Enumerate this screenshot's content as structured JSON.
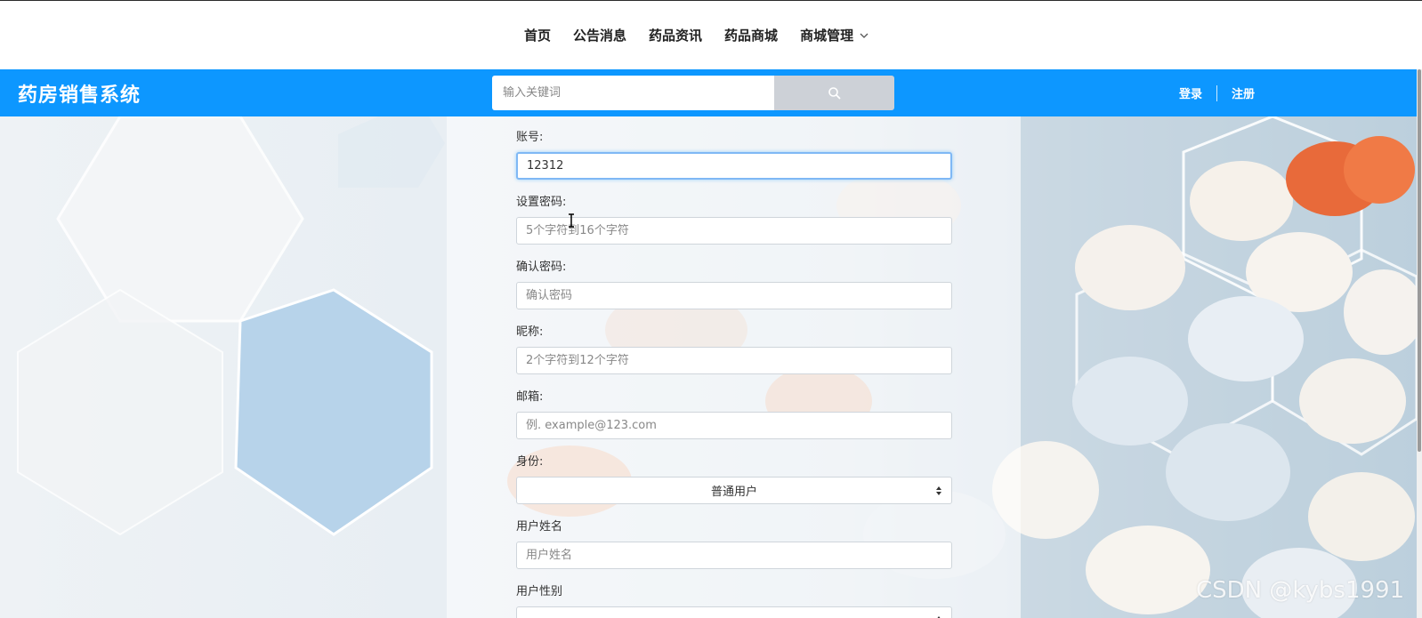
{
  "nav": {
    "items": [
      "首页",
      "公告消息",
      "药品资讯",
      "药品商城",
      "商城管理"
    ]
  },
  "header": {
    "brand": "药房销售系统",
    "search_placeholder": "输入关键词",
    "login": "登录",
    "register": "注册",
    "bar_color": "#0d97ff"
  },
  "form": {
    "account": {
      "label": "账号:",
      "value": "12312"
    },
    "password": {
      "label": "设置密码:",
      "placeholder": "5个字符到16个字符"
    },
    "confirm": {
      "label": "确认密码:",
      "placeholder": "确认密码"
    },
    "nickname": {
      "label": "昵称:",
      "placeholder": "2个字符到12个字符"
    },
    "email": {
      "label": "邮箱:",
      "placeholder": "例. example@123.com"
    },
    "role": {
      "label": "身份:",
      "value": "普通用户"
    },
    "realname": {
      "label": "用户姓名",
      "placeholder": "用户姓名"
    },
    "gender": {
      "label": "用户性别",
      "value": ""
    }
  },
  "watermark": "CSDN @kybs1991"
}
